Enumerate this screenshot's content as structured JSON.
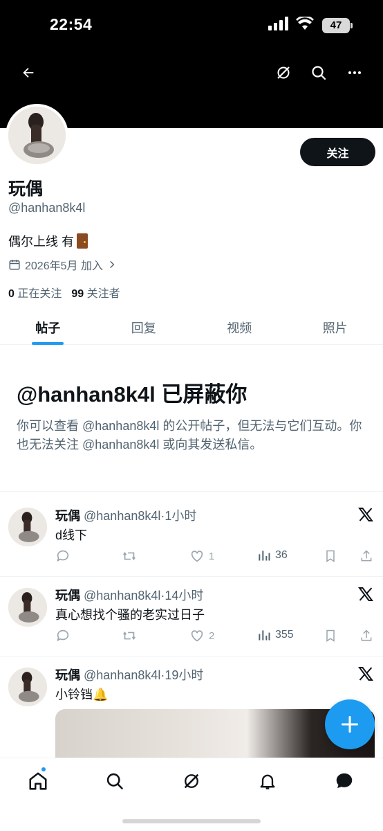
{
  "status_bar": {
    "time": "22:54",
    "battery": "47"
  },
  "header": {
    "back_icon": "back-arrow-icon",
    "grok_icon": "grok-icon",
    "search_icon": "search-icon",
    "more_icon": "more-icon"
  },
  "profile": {
    "display_name": "玩偶",
    "handle": "@hanhan8k4l",
    "bio": "偶尔上线 有",
    "bio_emoji": "door",
    "joined": "2026年5月 加入",
    "following_count": "0",
    "following_label": "正在关注",
    "followers_count": "99",
    "followers_label": "关注者",
    "follow_button": "关注"
  },
  "tabs": [
    {
      "label": "帖子",
      "active": true
    },
    {
      "label": "回复",
      "active": false
    },
    {
      "label": "视频",
      "active": false
    },
    {
      "label": "照片",
      "active": false
    }
  ],
  "blocked": {
    "title": "@hanhan8k4l 已屏蔽你",
    "description": "你可以查看 @hanhan8k4l 的公开帖子，但无法与它们互动。你也无法关注 @hanhan8k4l 或向其发送私信。"
  },
  "tweets": [
    {
      "name": "玩偶",
      "meta": "@hanhan8k4l·1小时",
      "text": "d线下",
      "likes": "1",
      "views": "36"
    },
    {
      "name": "玩偶",
      "meta": "@hanhan8k4l·14小时",
      "text": "真心想找个骚的老实过日子",
      "likes": "2",
      "views": "355"
    },
    {
      "name": "玩偶",
      "meta": "@hanhan8k4l·19小时",
      "text": "小铃铛🔔",
      "likes": "",
      "views": ""
    }
  ],
  "colors": {
    "accent": "#1d9bf0",
    "text": "#0f1419",
    "secondary": "#536471"
  }
}
